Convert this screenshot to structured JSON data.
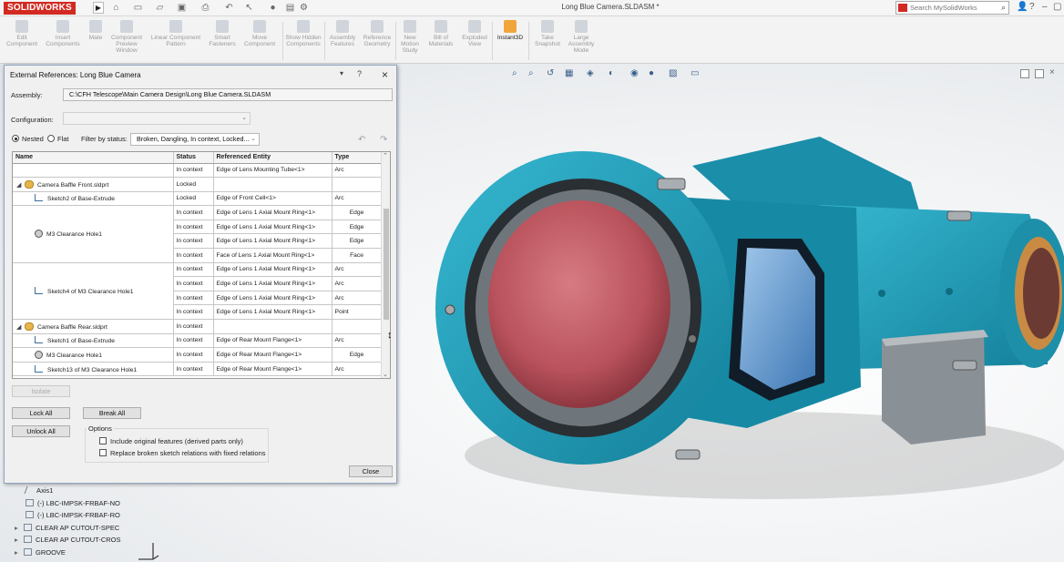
{
  "app": {
    "logo_text": "SOLIDWORKS",
    "document_title": "Long Blue Camera.SLDASM *",
    "search_placeholder": "Search MySolidWorks",
    "colors": {
      "brand": "#d22a21",
      "model_body": "#1a9bb8",
      "lens": "#c85d66",
      "active_tool": "#f0a63b"
    }
  },
  "ribbon": {
    "tools": [
      {
        "label": "Edit Component",
        "icon": "edit-component-icon"
      },
      {
        "label": "Insert Components",
        "icon": "insert-components-icon"
      },
      {
        "label": "Mate",
        "icon": "mate-icon"
      },
      {
        "label": "Component Preview Window",
        "icon": "component-preview-icon"
      },
      {
        "label": "Linear Component Pattern",
        "icon": "linear-pattern-icon"
      },
      {
        "label": "Smart Fasteners",
        "icon": "smart-fasteners-icon"
      },
      {
        "label": "Move Component",
        "icon": "move-component-icon"
      },
      {
        "label": "Show Hidden Components",
        "icon": "show-hidden-icon"
      },
      {
        "label": "Assembly Features",
        "icon": "assembly-features-icon"
      },
      {
        "label": "Reference Geometry",
        "icon": "reference-geometry-icon"
      },
      {
        "label": "New Motion Study",
        "icon": "motion-study-icon"
      },
      {
        "label": "Bill of Materials",
        "icon": "bom-icon"
      },
      {
        "label": "Exploded View",
        "icon": "exploded-view-icon"
      },
      {
        "label": "Instant3D",
        "icon": "instant3d-icon"
      },
      {
        "label": "Take Snapshot",
        "icon": "snapshot-icon"
      },
      {
        "label": "Large Assembly Mode",
        "icon": "large-assembly-icon"
      }
    ],
    "active_tool": "Instant3D"
  },
  "tree": {
    "items": [
      "Axis1",
      "(-) LBC-IMPSK-FRBAF-NO",
      "(-) LBC-IMPSK-FRBAF-RO",
      "CLEAR AP CUTOUT-SPEC",
      "CLEAR AP CUTOUT-CROS",
      "GROOVE"
    ]
  },
  "dialog": {
    "title": "External References: Long Blue Camera",
    "assembly_label": "Assembly:",
    "assembly_path": "C:\\CFH Telescope\\Main Camera Design\\Long Blue Camera.SLDASM",
    "configuration_label": "Configuration:",
    "configuration_value": "",
    "view_nested": "Nested",
    "view_flat": "Flat",
    "filter_label": "Filter by status:",
    "filter_value": "Broken, Dangling, In context, Locked...",
    "columns": [
      "Name",
      "Status",
      "Referenced Entity",
      "Type"
    ],
    "rows": [
      {
        "name": "",
        "status": "In context",
        "entity": "Edge of Lens Mounting Tube<1>",
        "type": "Arc"
      },
      {
        "name": "Camera Baffle Front.sldprt",
        "status": "Locked",
        "entity": "",
        "type": ""
      },
      {
        "name": "Sketch2  of  Base-Extrude",
        "status": "Locked",
        "entity": "Edge of Front Cell<1>",
        "type": "Arc"
      },
      {
        "name": "",
        "status": "In context",
        "entity": "Edge of Lens 1 Axial Mount Ring<1>",
        "type": "Edge"
      },
      {
        "name": "",
        "status": "In context",
        "entity": "Edge of Lens 1 Axial Mount Ring<1>",
        "type": "Edge"
      },
      {
        "name": "",
        "status": "In context",
        "entity": "Edge of Lens 1 Axial Mount Ring<1>",
        "type": "Edge"
      },
      {
        "name": "",
        "status": "In context",
        "entity": "Face of Lens 1 Axial Mount Ring<1>",
        "type": "Face"
      },
      {
        "name": "",
        "status": "In context",
        "entity": "Edge of Lens 1 Axial Mount Ring<1>",
        "type": "Arc"
      },
      {
        "name": "",
        "status": "In context",
        "entity": "Edge of Lens 1 Axial Mount Ring<1>",
        "type": "Arc"
      },
      {
        "name": "",
        "status": "In context",
        "entity": "Edge of Lens 1 Axial Mount Ring<1>",
        "type": "Arc"
      },
      {
        "name": "",
        "status": "In context",
        "entity": "Edge of Lens 1 Axial Mount Ring<1>",
        "type": "Point"
      },
      {
        "name": "Camera Baffle Rear.sldprt",
        "status": "In context",
        "entity": "",
        "type": ""
      },
      {
        "name": "Sketch1  of  Base-Extrude",
        "status": "In context",
        "entity": "Edge of Rear Mount Flange<1>",
        "type": "Arc"
      },
      {
        "name": "M3 Clearance Hole1",
        "status": "In context",
        "entity": "Edge of Rear Mount Flange<1>",
        "type": "Edge"
      },
      {
        "name": "Sketch13  of  M3 Clearance Hole1",
        "status": "In context",
        "entity": "Edge of Rear Mount Flange<1>",
        "type": "Arc"
      }
    ],
    "merged_names": {
      "m3_hole": "M3 Clearance Hole1",
      "sketch4": "Sketch4  of  M3 Clearance Hole1"
    },
    "buttons": {
      "isolate": "Isolate",
      "lock_all": "Lock All",
      "break_all": "Break All",
      "unlock_all": "Unlock All",
      "close": "Close"
    },
    "options_label": "Options",
    "opt_include": "Include original features (derived parts only)",
    "opt_replace": "Replace broken sketch relations with fixed relations"
  }
}
